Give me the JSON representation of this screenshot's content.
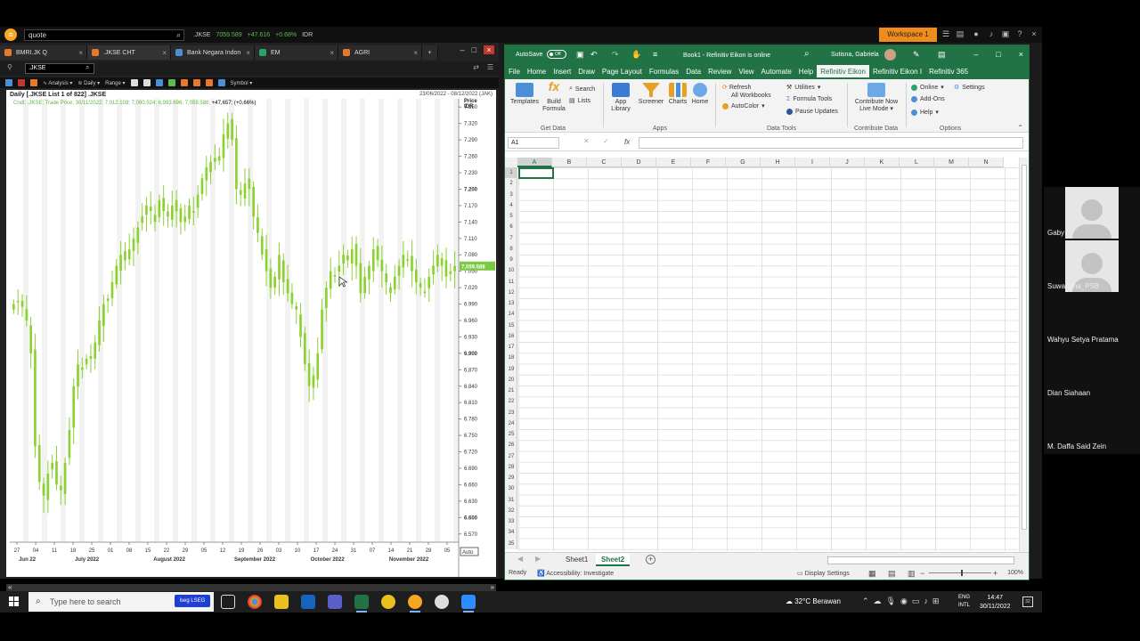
{
  "eikon": {
    "quote_box": "quote",
    "ticker": {
      "ric": ".JKSE",
      "last": "7059.589",
      "change": "+47.616",
      "pct": "+0.68%",
      "ccy": "IDR"
    },
    "workspace": "Workspace 1",
    "tabs": [
      {
        "label": "BMRI.JK Q",
        "icon_color": "#e8782b"
      },
      {
        "label": ".JKSE CHT",
        "icon_color": "#e8782b"
      },
      {
        "label": "Bank Negara Indon",
        "icon_color": "#4a90d9"
      },
      {
        "label": "EM",
        "icon_color": "#2ba36b"
      },
      {
        "label": "AGRI",
        "icon_color": "#e8782b"
      }
    ],
    "ric_input": ".JKSE",
    "toolbar": {
      "analysis": "Analysis",
      "daily": "Daily",
      "range": "Range",
      "symbol": "Symbol"
    },
    "chart": {
      "heading": "Daily [.JKSE List 1 of 822] .JKSE",
      "date_range": "23/06/2022 - 08/12/2022 (JAK)",
      "legend": "Cndl; .JKSE; Trade Price; 30/11/2022; 7,012.109; 7,080.524; 6,993.696; 7,059.588;",
      "legend_change": "+47,657; (+0,66%)",
      "price_label_1": "Price",
      "price_label_2": "IDR",
      "last_price_tag": "7,059.588",
      "auto_label": "Auto"
    }
  },
  "chart_data": {
    "type": "candlestick",
    "y_ticks": [
      "7.350",
      "7.320",
      "7.290",
      "7.260",
      "7.230",
      "7.200",
      "7.170",
      "7.140",
      "7.110",
      "7.080",
      "7.050",
      "7.020",
      "6.990",
      "6.960",
      "6.930",
      "6.900",
      "6.870",
      "6.840",
      "6.810",
      "6.780",
      "6.750",
      "6.720",
      "6.690",
      "6.660",
      "6.630",
      "6.600",
      "6.570"
    ],
    "ylim": [
      6555,
      7365
    ],
    "x_day_ticks": [
      "27",
      "04",
      "11",
      "18",
      "25",
      "01",
      "08",
      "15",
      "22",
      "29",
      "05",
      "12",
      "19",
      "26",
      "03",
      "10",
      "17",
      "24",
      "31",
      "07",
      "14",
      "21",
      "28",
      "05"
    ],
    "month_labels": [
      "Jun 22",
      "July 2022",
      "August 2022",
      "September 2022",
      "October 2022",
      "November 2022"
    ],
    "closes": [
      6990,
      6995,
      6985,
      6960,
      6900,
      6730,
      6665,
      6640,
      6680,
      6700,
      6660,
      6650,
      6700,
      6760,
      6840,
      6880,
      6870,
      6890,
      6890,
      6920,
      6960,
      6990,
      7000,
      7030,
      7060,
      7080,
      7070,
      7090,
      7110,
      7130,
      7150,
      7170,
      7160,
      7140,
      7180,
      7160,
      7150,
      7170,
      7160,
      7140,
      7150,
      7170,
      7160,
      7190,
      7220,
      7240,
      7250,
      7250,
      7260,
      7300,
      7320,
      7290,
      7200,
      7190,
      7210,
      7200,
      7150,
      7120,
      7080,
      7050,
      7020,
      7040,
      7080,
      7030,
      7010,
      6990,
      6980,
      6930,
      6880,
      6840,
      6860,
      6900,
      6980,
      7020,
      7050,
      7040,
      7060,
      7080,
      7070,
      7090,
      7060,
      7010,
      7040,
      7060,
      7090,
      7070,
      7050,
      7030,
      7010,
      7040,
      7060,
      7080,
      7070,
      7050,
      7030,
      7020,
      7010,
      7040,
      7060,
      7080,
      7060,
      7040,
      7050,
      7059.6
    ]
  },
  "excel": {
    "autosave": "AutoSave",
    "autosave_state": "Off",
    "doc_title": "Book1  -  Refinitiv Eikon is online",
    "user": "Sutisna, Gabriela",
    "menu": [
      "File",
      "Home",
      "Insert",
      "Draw",
      "Page Layout",
      "Formulas",
      "Data",
      "Review",
      "View",
      "Automate",
      "Help",
      "Refinitiv Eikon",
      "Refinitiv Eikon I",
      "Refinitiv 365"
    ],
    "ribbon": {
      "templates": "Templates",
      "build_formula_1": "Build",
      "build_formula_2": "Formula",
      "search": "Search",
      "lists": "Lists",
      "group_get_data": "Get Data",
      "app_library_1": "App",
      "app_library_2": "Library",
      "screener": "Screener",
      "charts": "Charts",
      "home": "Home",
      "group_apps": "Apps",
      "refresh_1": "Refresh",
      "refresh_2": "All Workbooks",
      "autocolor": "AutoColor",
      "utilities": "Utilities",
      "formula_tools": "Formula Tools",
      "pause_updates": "Pause Updates",
      "group_data_tools": "Data Tools",
      "contribute_1": "Contribute Now",
      "contribute_2": "Live Mode",
      "group_contribute": "Contribute Data",
      "online": "Online",
      "settings": "Settings",
      "addons": "Add-Ons",
      "help": "Help",
      "group_options": "Options"
    },
    "name_box": "A1",
    "columns": [
      "A",
      "B",
      "C",
      "D",
      "E",
      "F",
      "G",
      "H",
      "I",
      "J",
      "K",
      "L",
      "M",
      "N"
    ],
    "rows": [
      "1",
      "2",
      "3",
      "4",
      "5",
      "6",
      "7",
      "8",
      "9",
      "10",
      "11",
      "12",
      "13",
      "14",
      "15",
      "16",
      "17",
      "18",
      "19",
      "20",
      "21",
      "22",
      "23",
      "24",
      "25",
      "26",
      "27",
      "28",
      "29",
      "30",
      "31",
      "32",
      "33",
      "34",
      "35"
    ],
    "sheets": [
      "Sheet1",
      "Sheet2"
    ],
    "status_ready": "Ready",
    "status_accessibility": "Accessibility: Investigate",
    "display_settings": "Display Settings",
    "zoom": "100%"
  },
  "participants": [
    "Gaby",
    "Suwandha_PSB",
    "Wahyu Setya Pratama",
    "Dian Siahaan",
    "M. Daffa Said Zein"
  ],
  "taskbar": {
    "search_placeholder": "Type here to search",
    "lseg": "lseg LSEG",
    "weather": "32°C  Berawan",
    "lang_1": "ENG",
    "lang_2": "INTL",
    "time": "14:47",
    "date": "30/11/2022",
    "notifications": "32"
  }
}
